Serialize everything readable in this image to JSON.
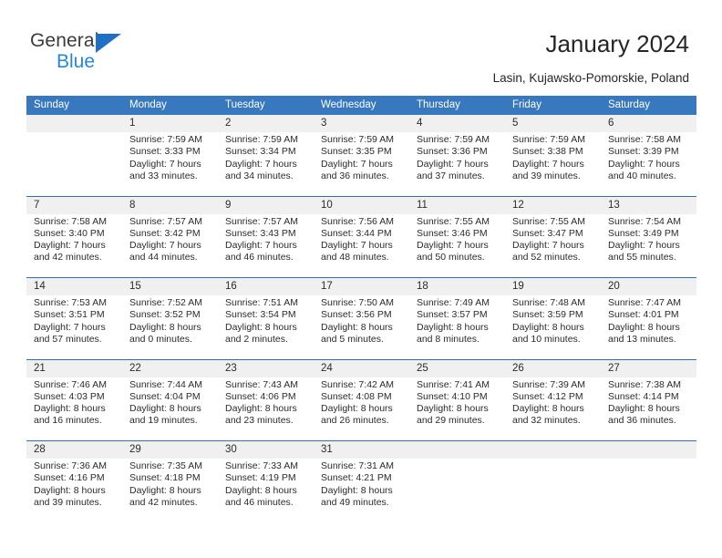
{
  "brand": {
    "name_top": "General",
    "name_bottom": "Blue",
    "accent_color": "#1f6fc4",
    "blue_text_color": "#2288dd"
  },
  "header": {
    "title": "January 2024",
    "subtitle": "Lasin, Kujawsko-Pomorskie, Poland"
  },
  "theme": {
    "header_bg": "#3778bf",
    "row_divider": "#2f6fb5",
    "date_band_bg": "#f0f0f0",
    "text": "#2b2b2b"
  },
  "weekdays": [
    "Sunday",
    "Monday",
    "Tuesday",
    "Wednesday",
    "Thursday",
    "Friday",
    "Saturday"
  ],
  "weeks": [
    {
      "numbers": [
        "",
        "1",
        "2",
        "3",
        "4",
        "5",
        "6"
      ],
      "details": [
        "",
        "Sunrise: 7:59 AM\nSunset: 3:33 PM\nDaylight: 7 hours\nand 33 minutes.",
        "Sunrise: 7:59 AM\nSunset: 3:34 PM\nDaylight: 7 hours\nand 34 minutes.",
        "Sunrise: 7:59 AM\nSunset: 3:35 PM\nDaylight: 7 hours\nand 36 minutes.",
        "Sunrise: 7:59 AM\nSunset: 3:36 PM\nDaylight: 7 hours\nand 37 minutes.",
        "Sunrise: 7:59 AM\nSunset: 3:38 PM\nDaylight: 7 hours\nand 39 minutes.",
        "Sunrise: 7:58 AM\nSunset: 3:39 PM\nDaylight: 7 hours\nand 40 minutes."
      ]
    },
    {
      "numbers": [
        "7",
        "8",
        "9",
        "10",
        "11",
        "12",
        "13"
      ],
      "details": [
        "Sunrise: 7:58 AM\nSunset: 3:40 PM\nDaylight: 7 hours\nand 42 minutes.",
        "Sunrise: 7:57 AM\nSunset: 3:42 PM\nDaylight: 7 hours\nand 44 minutes.",
        "Sunrise: 7:57 AM\nSunset: 3:43 PM\nDaylight: 7 hours\nand 46 minutes.",
        "Sunrise: 7:56 AM\nSunset: 3:44 PM\nDaylight: 7 hours\nand 48 minutes.",
        "Sunrise: 7:55 AM\nSunset: 3:46 PM\nDaylight: 7 hours\nand 50 minutes.",
        "Sunrise: 7:55 AM\nSunset: 3:47 PM\nDaylight: 7 hours\nand 52 minutes.",
        "Sunrise: 7:54 AM\nSunset: 3:49 PM\nDaylight: 7 hours\nand 55 minutes."
      ]
    },
    {
      "numbers": [
        "14",
        "15",
        "16",
        "17",
        "18",
        "19",
        "20"
      ],
      "details": [
        "Sunrise: 7:53 AM\nSunset: 3:51 PM\nDaylight: 7 hours\nand 57 minutes.",
        "Sunrise: 7:52 AM\nSunset: 3:52 PM\nDaylight: 8 hours\nand 0 minutes.",
        "Sunrise: 7:51 AM\nSunset: 3:54 PM\nDaylight: 8 hours\nand 2 minutes.",
        "Sunrise: 7:50 AM\nSunset: 3:56 PM\nDaylight: 8 hours\nand 5 minutes.",
        "Sunrise: 7:49 AM\nSunset: 3:57 PM\nDaylight: 8 hours\nand 8 minutes.",
        "Sunrise: 7:48 AM\nSunset: 3:59 PM\nDaylight: 8 hours\nand 10 minutes.",
        "Sunrise: 7:47 AM\nSunset: 4:01 PM\nDaylight: 8 hours\nand 13 minutes."
      ]
    },
    {
      "numbers": [
        "21",
        "22",
        "23",
        "24",
        "25",
        "26",
        "27"
      ],
      "details": [
        "Sunrise: 7:46 AM\nSunset: 4:03 PM\nDaylight: 8 hours\nand 16 minutes.",
        "Sunrise: 7:44 AM\nSunset: 4:04 PM\nDaylight: 8 hours\nand 19 minutes.",
        "Sunrise: 7:43 AM\nSunset: 4:06 PM\nDaylight: 8 hours\nand 23 minutes.",
        "Sunrise: 7:42 AM\nSunset: 4:08 PM\nDaylight: 8 hours\nand 26 minutes.",
        "Sunrise: 7:41 AM\nSunset: 4:10 PM\nDaylight: 8 hours\nand 29 minutes.",
        "Sunrise: 7:39 AM\nSunset: 4:12 PM\nDaylight: 8 hours\nand 32 minutes.",
        "Sunrise: 7:38 AM\nSunset: 4:14 PM\nDaylight: 8 hours\nand 36 minutes."
      ]
    },
    {
      "numbers": [
        "28",
        "29",
        "30",
        "31",
        "",
        "",
        ""
      ],
      "details": [
        "Sunrise: 7:36 AM\nSunset: 4:16 PM\nDaylight: 8 hours\nand 39 minutes.",
        "Sunrise: 7:35 AM\nSunset: 4:18 PM\nDaylight: 8 hours\nand 42 minutes.",
        "Sunrise: 7:33 AM\nSunset: 4:19 PM\nDaylight: 8 hours\nand 46 minutes.",
        "Sunrise: 7:31 AM\nSunset: 4:21 PM\nDaylight: 8 hours\nand 49 minutes.",
        "",
        "",
        ""
      ]
    }
  ]
}
